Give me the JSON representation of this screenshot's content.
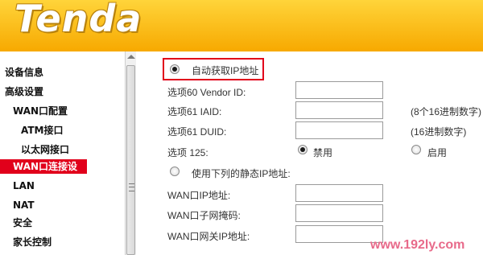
{
  "header": {
    "logo_text": "Tenda"
  },
  "sidebar": {
    "items": [
      {
        "label": "设备信息"
      },
      {
        "label": "高级设置"
      },
      {
        "label": "WAN口配置"
      },
      {
        "label": "ATM接口"
      },
      {
        "label": "以太网接口"
      },
      {
        "label": "WAN口连接设置"
      },
      {
        "label": "LAN"
      },
      {
        "label": "NAT"
      },
      {
        "label": "安全"
      },
      {
        "label": "家长控制"
      }
    ]
  },
  "main": {
    "auto_ip_label": "自动获取IP地址",
    "option60_label": "选项60 Vendor ID:",
    "option61_iaid_label": "选项61 IAID:",
    "option61_iaid_hint": "(8个16进制数字)",
    "option61_duid_label": "选项61 DUID:",
    "option61_duid_hint": "(16进制数字)",
    "option125_label": "选项 125:",
    "disable_label": "禁用",
    "enable_label": "启用",
    "static_ip_label": "使用下列的静态IP地址:",
    "wan_ip_label": "WAN口IP地址:",
    "wan_mask_label": "WAN口子网掩码:",
    "wan_gateway_label": "WAN口网关IP地址:"
  },
  "watermark": "www.192ly.com",
  "colors": {
    "header_top": "#ffd43a",
    "header_bottom": "#f7a900",
    "active_menu": "#e1001b",
    "highlight": "#e1001b"
  }
}
